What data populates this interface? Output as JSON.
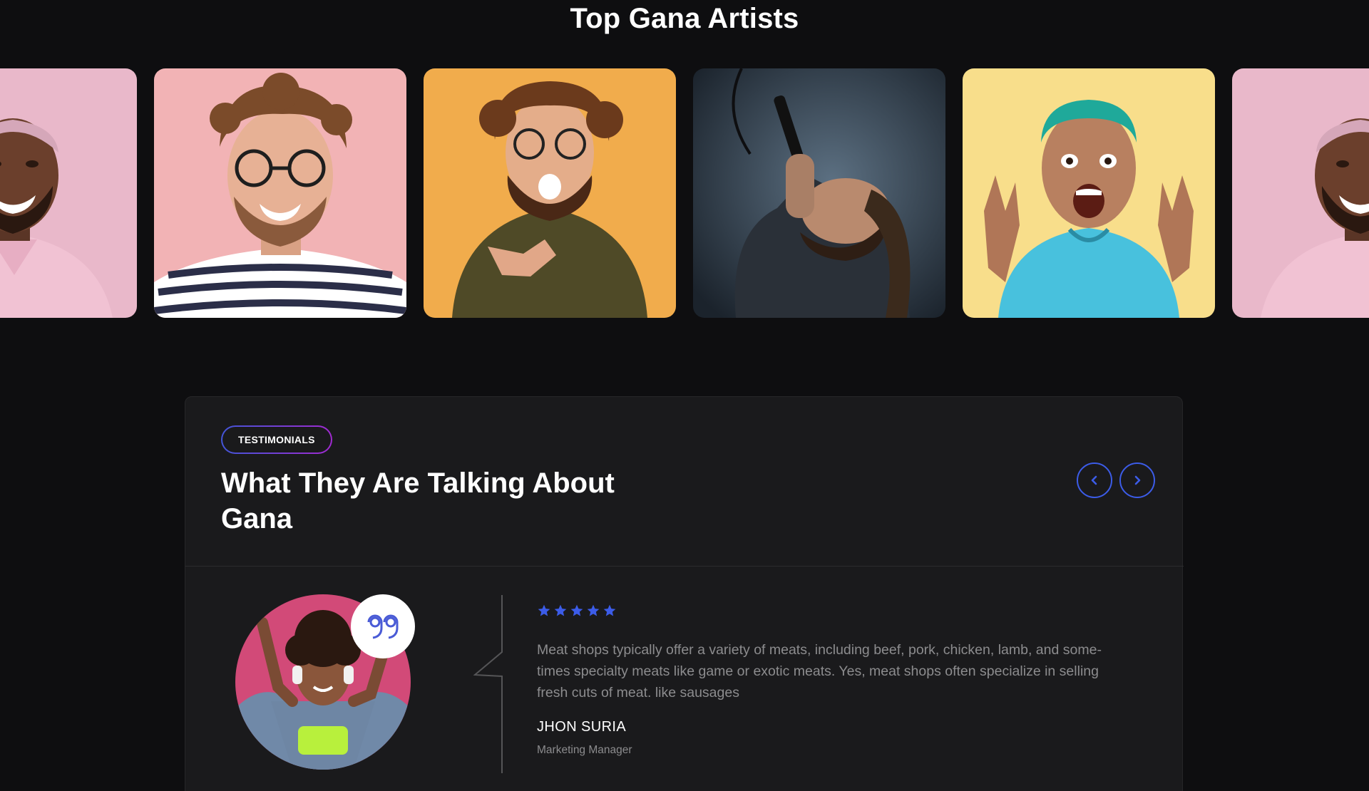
{
  "artists_section": {
    "title": "Top Gana Artists",
    "artists": [
      {
        "icon": "artist-photo-pink-smiling-man"
      },
      {
        "icon": "artist-photo-curly-glasses-man"
      },
      {
        "icon": "artist-photo-pointing-man"
      },
      {
        "icon": "artist-photo-singer-microphone"
      },
      {
        "icon": "artist-photo-excited-teal-hair-man"
      },
      {
        "icon": "artist-photo-pink-smiling-man"
      }
    ]
  },
  "testimonials": {
    "badge": "TESTIMONIALS",
    "heading": "What They Are Talking About Gana",
    "nav": {
      "prev_icon": "chevron-left-icon",
      "next_icon": "chevron-right-icon"
    },
    "review": {
      "rating": 5,
      "text": "Meat shops typically offer a variety of meats, including beef, pork, chicken, lamb, and some-times specialty meats like game or exotic meats. Yes, meat shops often specialize in selling fresh cuts of meat. like sausages",
      "name": "JHON SURIA",
      "role": "Marketing Manager",
      "avatar_icon": "reviewer-avatar",
      "quote_icon": "quote-icon"
    }
  },
  "colors": {
    "background": "#0e0e10",
    "card": "#1a1a1c",
    "accent_blue": "#3c5ce8",
    "accent_purple": "#a12ad1",
    "muted_text": "#8c8c8e"
  }
}
